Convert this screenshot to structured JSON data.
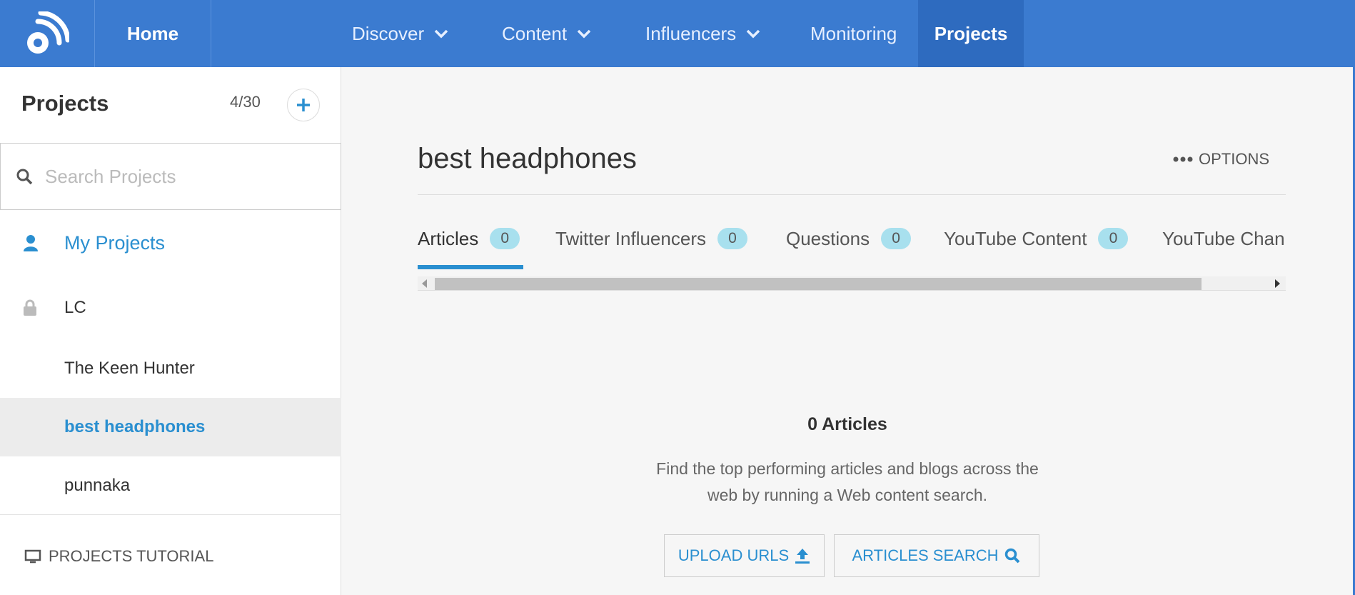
{
  "topnav": {
    "home": "Home",
    "items": [
      {
        "label": "Discover",
        "has_dropdown": true
      },
      {
        "label": "Content",
        "has_dropdown": true
      },
      {
        "label": "Influencers",
        "has_dropdown": true
      },
      {
        "label": "Monitoring",
        "has_dropdown": false
      },
      {
        "label": "Projects",
        "has_dropdown": false,
        "active": true
      }
    ]
  },
  "sidebar": {
    "title": "Projects",
    "count": "4/30",
    "add_icon": "plus-icon",
    "search_placeholder": "Search Projects",
    "items": [
      {
        "label": "My Projects",
        "icon": "user-icon"
      },
      {
        "label": "LC",
        "icon": "lock-icon"
      },
      {
        "label": "The Keen Hunter"
      },
      {
        "label": "best headphones",
        "selected": true
      },
      {
        "label": "punnaka"
      }
    ],
    "tutorial": "PROJECTS TUTORIAL"
  },
  "main": {
    "title": "best headphones",
    "options": "OPTIONS",
    "tabs": [
      {
        "label": "Articles",
        "count": "0",
        "active": true
      },
      {
        "label": "Twitter Influencers",
        "count": "0"
      },
      {
        "label": "Questions",
        "count": "0"
      },
      {
        "label": "YouTube Content",
        "count": "0"
      },
      {
        "label": "YouTube Chan"
      }
    ],
    "empty": {
      "title": "0 Articles",
      "line1": "Find the top performing articles and blogs across the",
      "line2": "web by running a Web content search."
    },
    "buttons": {
      "upload": "UPLOAD URLS",
      "search": "ARTICLES SEARCH"
    }
  },
  "colors": {
    "nav_bg": "#3b7bd0",
    "nav_active_bg": "#2e6bbf",
    "accent": "#2a8fd0",
    "badge_bg": "#a8e0ee"
  }
}
